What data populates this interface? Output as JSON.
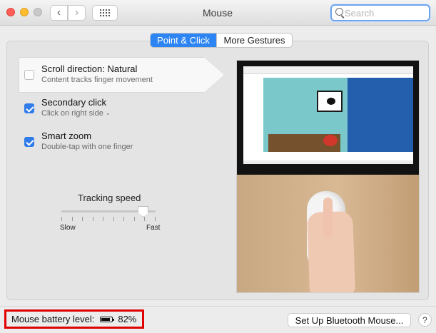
{
  "window": {
    "title": "Mouse"
  },
  "toolbar": {
    "back_icon": "chevron-left-icon",
    "forward_icon": "chevron-right-icon",
    "grid_icon": "grid-icon",
    "search_placeholder": "Search",
    "search_value": ""
  },
  "tabs": [
    {
      "label": "Point & Click",
      "selected": true
    },
    {
      "label": "More Gestures",
      "selected": false
    }
  ],
  "options": [
    {
      "title": "Scroll direction: Natural",
      "subtitle": "Content tracks finger movement",
      "checked": false
    },
    {
      "title": "Secondary click",
      "subtitle": "Click on right side",
      "checked": true
    },
    {
      "title": "Smart zoom",
      "subtitle": "Double-tap with one finger",
      "checked": true
    }
  ],
  "tracking": {
    "title": "Tracking speed",
    "min_label": "Slow",
    "max_label": "Fast",
    "value_fraction": 0.87
  },
  "battery": {
    "label": "Mouse battery level:",
    "percent": "82%",
    "level_fraction": 0.82
  },
  "footer": {
    "setup_button": "Set Up Bluetooth Mouse...",
    "help_label": "?"
  },
  "colors": {
    "accent": "#2d85f4",
    "checkbox_checked": "#2f7bea",
    "highlight_border": "#e00000"
  }
}
